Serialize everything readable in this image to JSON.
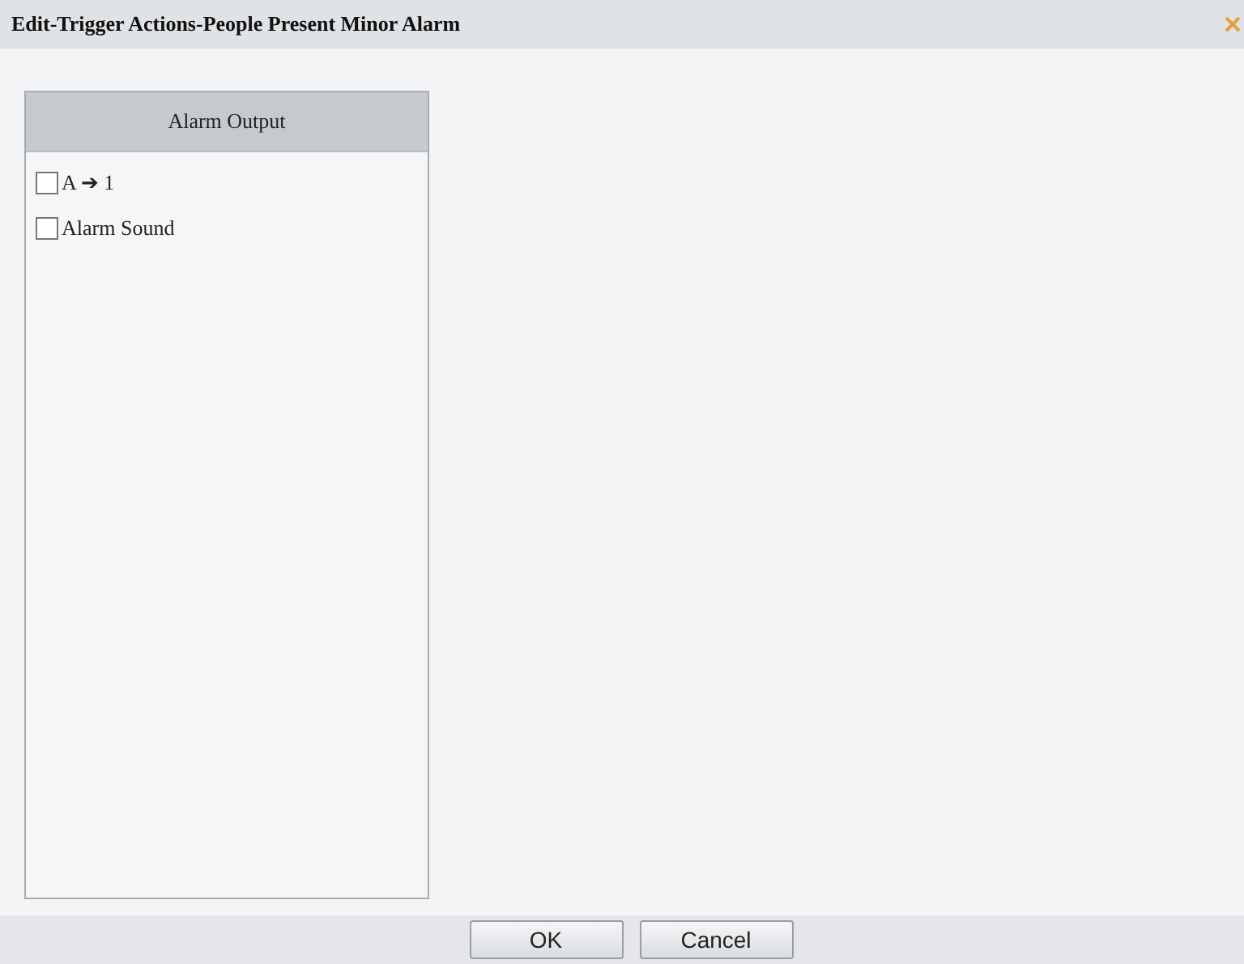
{
  "window": {
    "title": "Edit-Trigger Actions-People Present Minor Alarm"
  },
  "panel": {
    "heading": "Alarm Output",
    "items": [
      {
        "label": "A ➔ 1",
        "checked": false
      },
      {
        "label": "Alarm Sound",
        "checked": false
      }
    ]
  },
  "buttons": [
    "OK",
    "Cancel"
  ]
}
